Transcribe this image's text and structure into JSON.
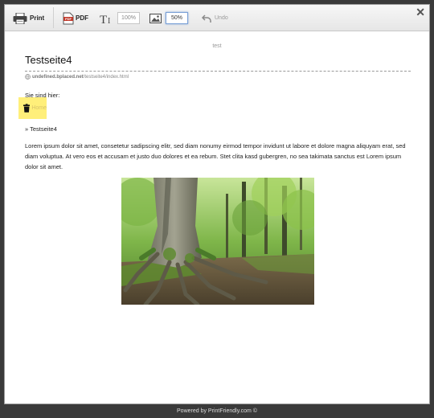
{
  "toolbar": {
    "print_label": "Print",
    "pdf_label": "PDF",
    "text_size_value": "100%",
    "image_size_value": "50%",
    "undo_label": "Undo"
  },
  "close_symbol": "✕",
  "page": {
    "header_text": "test",
    "title": "Testseite4",
    "url_domain": "undefined.bplaced.net",
    "url_path": "/testseite4/index.html",
    "breadcrumb_intro": "Sie sind hier:",
    "home_link": "Home",
    "breadcrumb_current": "» Testseite4",
    "paragraph": "Lorem ipsum dolor sit amet, consetetur sadipscing elitr, sed diam nonumy eirmod tempor invidunt ut labore et dolore magna aliquyam erat, sed diam voluptua. At vero eos et accusam et justo duo dolores et ea rebum. Stet clita kasd gubergren, no sea takimata sanctus est Lorem ipsum dolor sit amet."
  },
  "footer": {
    "text": "Powered by PrintFriendly.com ©"
  },
  "icons": {
    "print": "printer-icon",
    "pdf": "pdf-icon",
    "text_size": "text-size-icon",
    "image_size": "image-size-icon",
    "undo": "undo-icon",
    "close": "close-icon",
    "delete": "trash-icon",
    "link": "link-icon"
  },
  "colors": {
    "highlight": "#ffef7a",
    "toolbar_bg": "#ececec",
    "backdrop": "#3a3a3a"
  }
}
